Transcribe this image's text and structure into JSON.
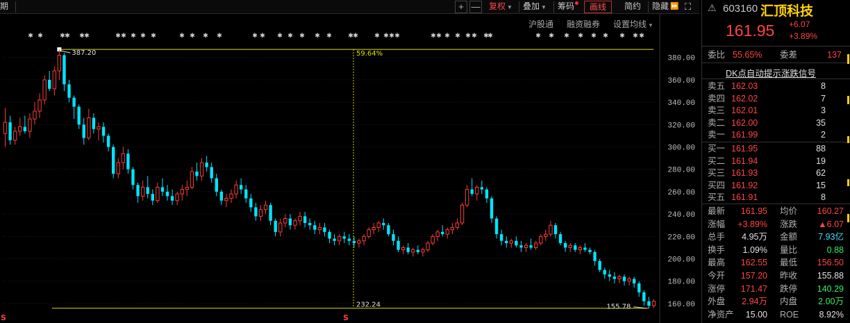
{
  "toolbar": {
    "period_partial": "期",
    "plus": "+",
    "minus": "—",
    "fuquan": "复权",
    "diejia": "叠加",
    "chouma": "筹码",
    "huaxian": "画线",
    "jianyue": "简约",
    "yincang": "隐藏",
    "ffwd": "⏩",
    "expand": "⛶"
  },
  "subheader": {
    "hugutong": "沪股通",
    "rongzi": "融资融券",
    "shezhi": "设置均线"
  },
  "markers": {
    "star_glyph": "✱",
    "arrow_glyph": "⇟",
    "s_glyph": "S"
  },
  "chart_data": {
    "type": "candlestick",
    "y_axis_ticks": [
      "380.00",
      "360.00",
      "340.00",
      "320.00",
      "300.00",
      "280.00",
      "260.00",
      "240.00",
      "220.00",
      "200.00",
      "180.00",
      "160.00"
    ],
    "ylim": [
      160,
      380
    ],
    "high_label": "387.20",
    "low_label": "155.78",
    "crosshair_pct_top": "59.64%",
    "crosshair_pct_bottom": "232.24",
    "colors": {
      "up": "#ff3b3b",
      "down": "#00e5ff",
      "guide": "#e0e000",
      "grid": "#222"
    },
    "candles": [
      [
        312,
        335,
        300,
        322
      ],
      [
        322,
        328,
        302,
        306
      ],
      [
        306,
        318,
        302,
        314
      ],
      [
        314,
        326,
        310,
        318
      ],
      [
        318,
        328,
        312,
        314
      ],
      [
        314,
        330,
        308,
        325
      ],
      [
        325,
        340,
        320,
        332
      ],
      [
        332,
        348,
        326,
        342
      ],
      [
        342,
        364,
        338,
        360
      ],
      [
        360,
        368,
        350,
        352
      ],
      [
        352,
        372,
        346,
        368
      ],
      [
        368,
        387.2,
        360,
        382
      ],
      [
        382,
        384,
        350,
        356
      ],
      [
        356,
        360,
        340,
        344
      ],
      [
        344,
        346,
        325,
        336
      ],
      [
        336,
        338,
        316,
        320
      ],
      [
        320,
        326,
        302,
        308
      ],
      [
        308,
        334,
        306,
        326
      ],
      [
        326,
        330,
        312,
        316
      ],
      [
        316,
        322,
        306,
        318
      ],
      [
        318,
        322,
        304,
        310
      ],
      [
        310,
        312,
        296,
        300
      ],
      [
        300,
        302,
        272,
        276
      ],
      [
        276,
        290,
        272,
        286
      ],
      [
        286,
        300,
        280,
        294
      ],
      [
        294,
        298,
        276,
        280
      ],
      [
        280,
        282,
        262,
        266
      ],
      [
        266,
        268,
        250,
        256
      ],
      [
        256,
        270,
        252,
        264
      ],
      [
        264,
        274,
        254,
        258
      ],
      [
        258,
        262,
        248,
        252
      ],
      [
        252,
        268,
        250,
        264
      ],
      [
        264,
        272,
        256,
        260
      ],
      [
        260,
        266,
        252,
        256
      ],
      [
        256,
        262,
        248,
        252
      ],
      [
        252,
        260,
        248,
        258
      ],
      [
        258,
        266,
        252,
        262
      ],
      [
        262,
        270,
        256,
        264
      ],
      [
        264,
        282,
        262,
        278
      ],
      [
        278,
        286,
        270,
        274
      ],
      [
        274,
        290,
        270,
        286
      ],
      [
        286,
        292,
        278,
        282
      ],
      [
        282,
        286,
        268,
        272
      ],
      [
        272,
        276,
        256,
        260
      ],
      [
        260,
        262,
        248,
        252
      ],
      [
        252,
        258,
        246,
        254
      ],
      [
        254,
        262,
        250,
        258
      ],
      [
        258,
        270,
        254,
        266
      ],
      [
        266,
        272,
        258,
        262
      ],
      [
        262,
        266,
        250,
        254
      ],
      [
        254,
        258,
        242,
        246
      ],
      [
        246,
        250,
        234,
        238
      ],
      [
        238,
        248,
        234,
        244
      ],
      [
        244,
        252,
        240,
        248
      ],
      [
        248,
        250,
        230,
        234
      ],
      [
        234,
        236,
        220,
        224
      ],
      [
        224,
        236,
        220,
        232
      ],
      [
        232,
        240,
        228,
        236
      ],
      [
        236,
        240,
        226,
        230
      ],
      [
        230,
        236,
        226,
        234
      ],
      [
        234,
        242,
        230,
        238
      ],
      [
        238,
        242,
        228,
        232
      ],
      [
        232,
        236,
        226,
        230
      ],
      [
        230,
        234,
        222,
        226
      ],
      [
        226,
        232,
        222,
        228
      ],
      [
        228,
        232,
        220,
        224
      ],
      [
        224,
        226,
        214,
        218
      ],
      [
        218,
        222,
        212,
        216
      ],
      [
        216,
        222,
        212,
        220
      ],
      [
        220,
        224,
        214,
        218
      ],
      [
        218,
        222,
        212,
        216
      ],
      [
        216,
        220,
        210,
        214
      ],
      [
        214,
        218,
        210,
        216
      ],
      [
        216,
        222,
        212,
        220
      ],
      [
        220,
        228,
        218,
        226
      ],
      [
        226,
        232,
        222,
        228
      ],
      [
        228,
        234,
        224,
        232
      ],
      [
        232,
        236,
        226,
        230
      ],
      [
        230,
        232,
        220,
        222
      ],
      [
        222,
        226,
        212,
        216
      ],
      [
        216,
        220,
        206,
        208
      ],
      [
        208,
        212,
        204,
        210
      ],
      [
        210,
        214,
        204,
        206
      ],
      [
        206,
        210,
        202,
        208
      ],
      [
        208,
        212,
        204,
        206
      ],
      [
        206,
        210,
        202,
        208
      ],
      [
        208,
        216,
        206,
        214
      ],
      [
        214,
        222,
        212,
        220
      ],
      [
        220,
        226,
        216,
        224
      ],
      [
        224,
        230,
        220,
        222
      ],
      [
        222,
        228,
        218,
        226
      ],
      [
        226,
        232,
        222,
        228
      ],
      [
        228,
        236,
        226,
        232
      ],
      [
        232,
        250,
        230,
        248
      ],
      [
        248,
        266,
        246,
        262
      ],
      [
        262,
        272,
        256,
        258
      ],
      [
        258,
        266,
        252,
        264
      ],
      [
        264,
        270,
        258,
        262
      ],
      [
        262,
        264,
        250,
        254
      ],
      [
        254,
        256,
        232,
        236
      ],
      [
        236,
        238,
        218,
        222
      ],
      [
        222,
        226,
        212,
        216
      ],
      [
        216,
        220,
        210,
        214
      ],
      [
        214,
        218,
        210,
        216
      ],
      [
        216,
        220,
        210,
        212
      ],
      [
        212,
        216,
        206,
        210
      ],
      [
        210,
        214,
        206,
        212
      ],
      [
        212,
        218,
        208,
        210
      ],
      [
        210,
        216,
        208,
        214
      ],
      [
        214,
        222,
        212,
        220
      ],
      [
        220,
        226,
        216,
        222
      ],
      [
        222,
        234,
        220,
        230
      ],
      [
        230,
        232,
        218,
        222
      ],
      [
        222,
        224,
        212,
        214
      ],
      [
        214,
        216,
        206,
        210
      ],
      [
        210,
        214,
        206,
        212
      ],
      [
        212,
        214,
        206,
        208
      ],
      [
        208,
        212,
        204,
        210
      ],
      [
        210,
        214,
        206,
        208
      ],
      [
        208,
        210,
        204,
        206
      ],
      [
        206,
        208,
        194,
        198
      ],
      [
        198,
        200,
        188,
        190
      ],
      [
        190,
        192,
        182,
        186
      ],
      [
        186,
        190,
        180,
        184
      ],
      [
        184,
        188,
        178,
        182
      ],
      [
        182,
        186,
        178,
        184
      ],
      [
        184,
        186,
        176,
        180
      ],
      [
        180,
        184,
        176,
        182
      ],
      [
        182,
        184,
        174,
        178
      ],
      [
        178,
        180,
        166,
        170
      ],
      [
        170,
        172,
        158,
        162
      ],
      [
        162,
        166,
        155.78,
        158
      ],
      [
        158,
        164,
        156,
        161.95
      ]
    ]
  },
  "panel": {
    "warn": "⚠",
    "code": "603160",
    "name": "汇顶科技",
    "price": "161.95",
    "change": "+6.07",
    "change_pct": "+3.89%",
    "weibi_lbl": "委比",
    "weibi_val": "55.65%",
    "weicha_lbl": "委差",
    "weicha_val": "137",
    "dk_link": "DK点自动提示涨跌信号",
    "asks": [
      {
        "lbl": "卖五",
        "price": "162.03",
        "vol": "8"
      },
      {
        "lbl": "卖四",
        "price": "162.02",
        "vol": "7"
      },
      {
        "lbl": "卖三",
        "price": "162.01",
        "vol": "3"
      },
      {
        "lbl": "卖二",
        "price": "162.00",
        "vol": "35"
      },
      {
        "lbl": "卖一",
        "price": "161.99",
        "vol": "2"
      }
    ],
    "bids": [
      {
        "lbl": "买一",
        "price": "161.95",
        "vol": "88"
      },
      {
        "lbl": "买二",
        "price": "161.94",
        "vol": "19"
      },
      {
        "lbl": "买三",
        "price": "161.93",
        "vol": "62"
      },
      {
        "lbl": "买四",
        "price": "161.92",
        "vol": "15"
      },
      {
        "lbl": "买五",
        "price": "161.91",
        "vol": "8"
      }
    ],
    "stats": [
      {
        "l1": "最新",
        "v1": "161.95",
        "c1": "up",
        "l2": "均价",
        "v2": "160.27",
        "c2": "up"
      },
      {
        "l1": "涨幅",
        "v1": "+3.89%",
        "c1": "up",
        "l2": "涨跌",
        "v2": "▲6.07",
        "c2": "up"
      },
      {
        "l1": "总手",
        "v1": "4.95万",
        "c1": "wt",
        "l2": "金额",
        "v2": "7.93亿",
        "c2": "cy"
      },
      {
        "l1": "换手",
        "v1": "1.09%",
        "c1": "wt",
        "l2": "量比",
        "v2": "0.88",
        "c2": "dn"
      },
      {
        "l1": "最高",
        "v1": "162.55",
        "c1": "up",
        "l2": "最低",
        "v2": "156.50",
        "c2": "up"
      },
      {
        "l1": "今开",
        "v1": "157.20",
        "c1": "up",
        "l2": "昨收",
        "v2": "155.88",
        "c2": "wt"
      },
      {
        "l1": "涨停",
        "v1": "171.47",
        "c1": "up",
        "l2": "跌停",
        "v2": "140.29",
        "c2": "dn"
      },
      {
        "l1": "外盘",
        "v1": "2.94万",
        "c1": "up",
        "l2": "内盘",
        "v2": "2.00万",
        "c2": "dn"
      },
      {
        "l1": "净资产",
        "v1": "15.00",
        "c1": "wt",
        "l2": "ROE",
        "v2": "8.92%",
        "c2": "wt"
      }
    ]
  }
}
